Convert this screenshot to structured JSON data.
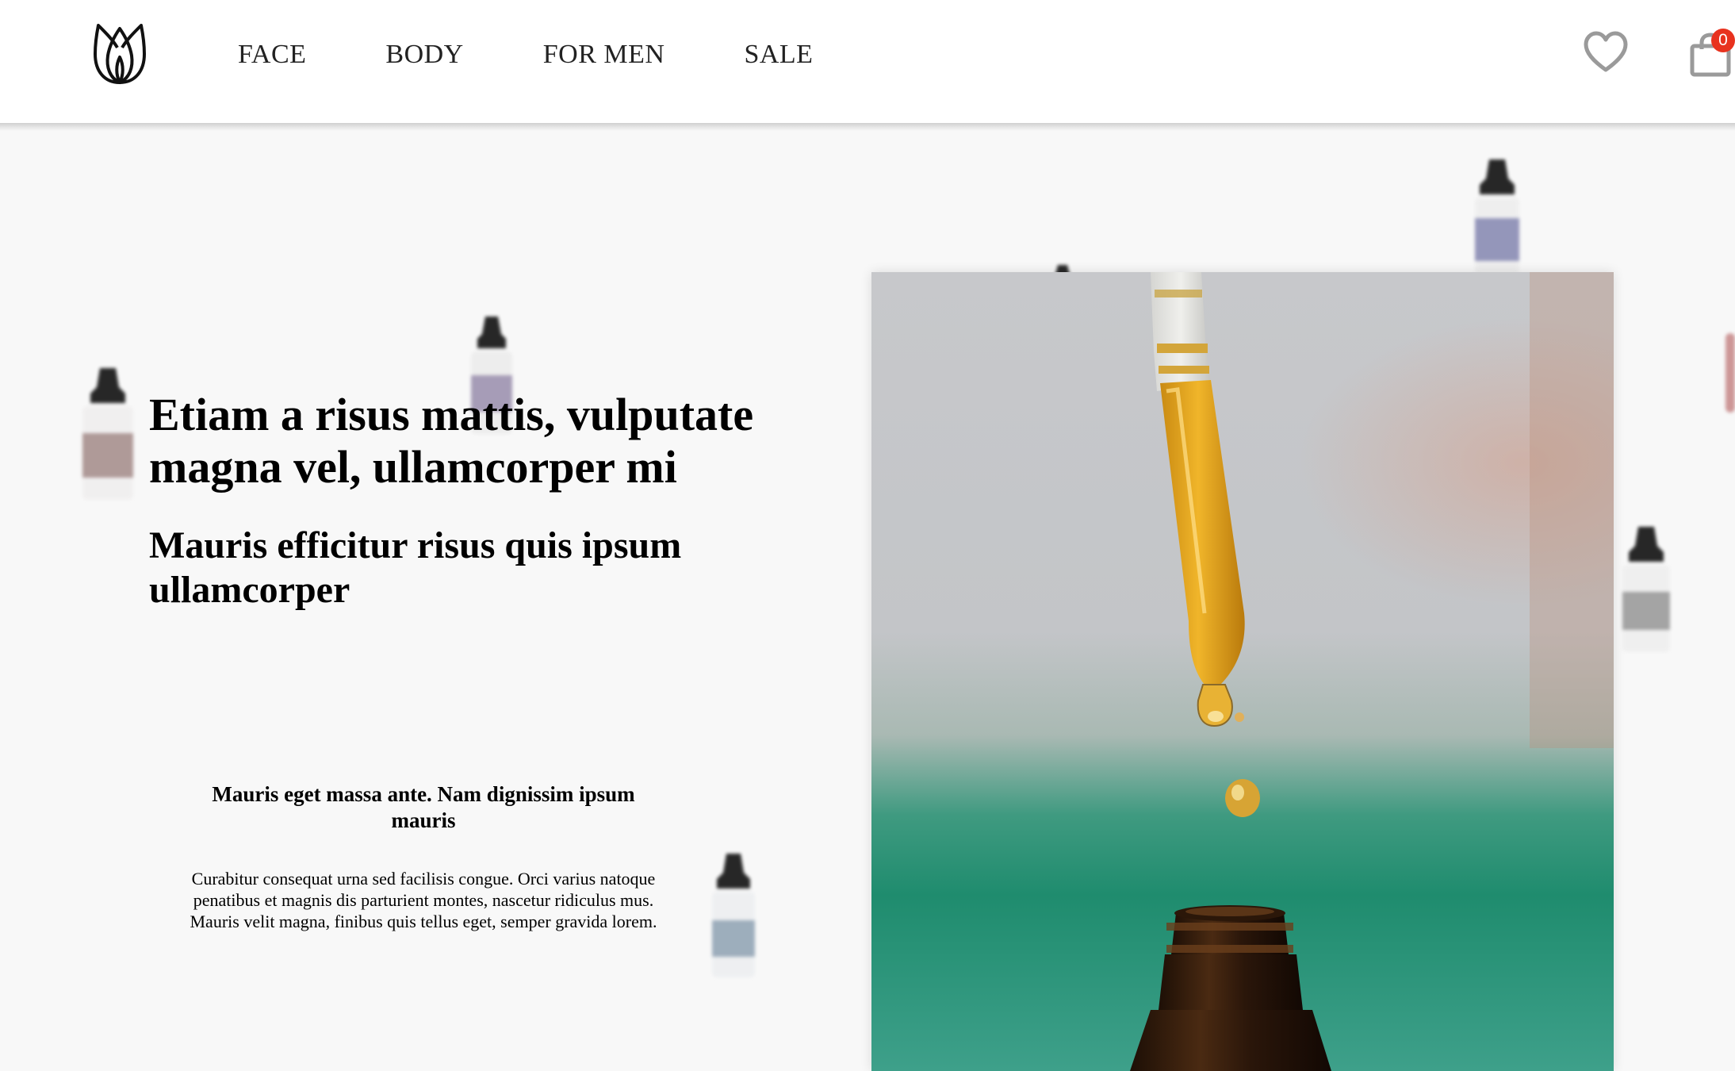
{
  "header": {
    "logo_icon": "lotus-logo-icon",
    "nav": [
      {
        "label": "FACE"
      },
      {
        "label": "BODY"
      },
      {
        "label": "FOR MEN"
      },
      {
        "label": "SALE"
      }
    ],
    "wishlist_icon": "heart-icon",
    "cart_icon": "shopping-bag-icon",
    "cart_count": "0",
    "badge_color": "#e8321e"
  },
  "hero": {
    "title": "Etiam a risus mattis, vulputate magna vel, ullamcorper mi",
    "subtitle": "Mauris efficitur risus quis ipsum ullamcorper",
    "feature_title": "Mauris eget massa ante. Nam dignissim ipsum mauris",
    "feature_body": "Curabitur consequat urna sed facilisis congue. Orci varius natoque penatibus et magnis dis parturient montes, nascetur ridiculus mus. Mauris velit magna, finibus quis tellus eget, semper gravida lorem.",
    "image": "dropper-oil-bottle-photo"
  }
}
